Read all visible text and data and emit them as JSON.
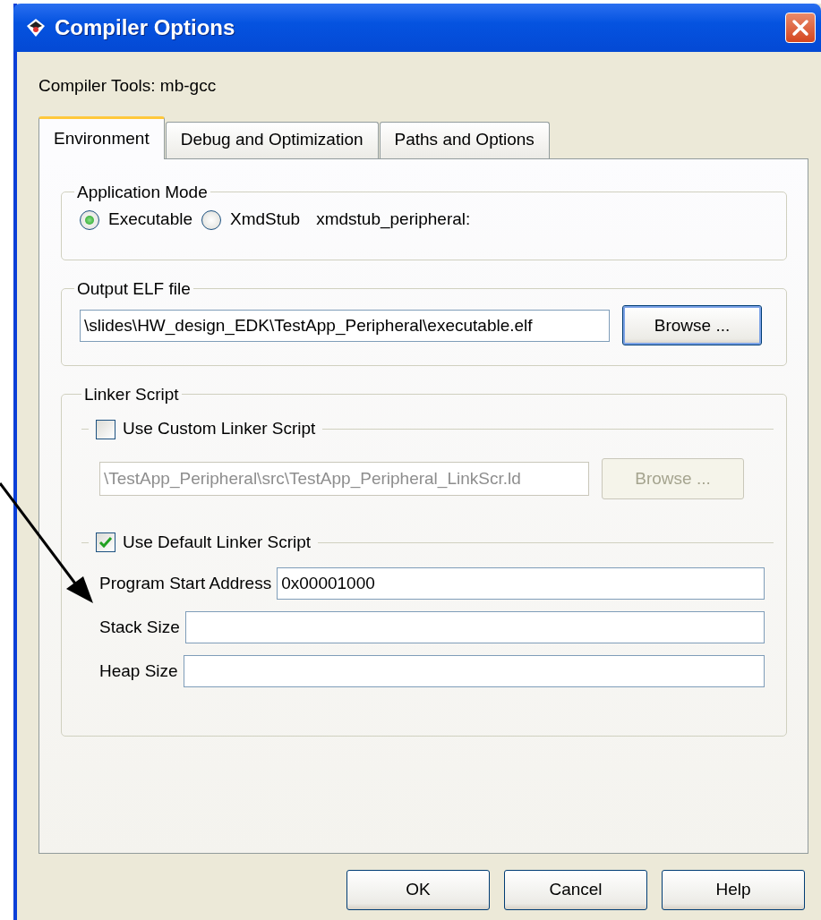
{
  "window": {
    "title": "Compiler Options"
  },
  "compiler_tools": "Compiler Tools: mb-gcc",
  "tabs": [
    {
      "label": "Environment",
      "selected": true
    },
    {
      "label": "Debug and Optimization",
      "selected": false
    },
    {
      "label": "Paths and Options",
      "selected": false
    }
  ],
  "application_mode": {
    "title": "Application Mode",
    "options": [
      {
        "label": "Executable",
        "selected": true
      },
      {
        "label": "XmdStub",
        "selected": false
      }
    ],
    "peripheral_label": "xmdstub_peripheral:"
  },
  "output_elf": {
    "title": "Output ELF file",
    "value": "\\slides\\HW_design_EDK\\TestApp_Peripheral\\executable.elf",
    "browse": "Browse ..."
  },
  "linker_script": {
    "title": "Linker Script",
    "custom": {
      "label": "Use Custom Linker Script",
      "checked": false,
      "disabled": true,
      "value": "\\TestApp_Peripheral\\src\\TestApp_Peripheral_LinkScr.ld",
      "browse": "Browse ..."
    },
    "default": {
      "label": "Use Default Linker Script",
      "checked": true,
      "fields": [
        {
          "label": "Program Start Address",
          "value": "0x00001000"
        },
        {
          "label": "Stack Size"
        },
        {
          "label": "Heap Size"
        }
      ]
    }
  },
  "buttons": [
    "OK",
    "Cancel",
    "Help"
  ]
}
